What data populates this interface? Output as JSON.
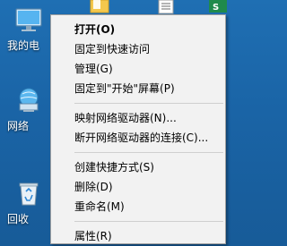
{
  "desktop": {
    "icons": [
      {
        "label": "我的电",
        "icon": "computer-icon"
      },
      {
        "label": "网络",
        "icon": "network-icon"
      },
      {
        "label": "回收",
        "icon": "recycle-bin-icon"
      }
    ],
    "top_icons": [
      "folder-icon",
      "document-icon",
      "spreadsheet-icon"
    ]
  },
  "context_menu": {
    "groups": [
      [
        {
          "label": "打开(O)",
          "default": true
        },
        {
          "label": "固定到快速访问"
        },
        {
          "label": "管理(G)"
        },
        {
          "label": "固定到\"开始\"屏幕(P)"
        }
      ],
      [
        {
          "label": "映射网络驱动器(N)..."
        },
        {
          "label": "断开网络驱动器的连接(C)..."
        }
      ],
      [
        {
          "label": "创建快捷方式(S)"
        },
        {
          "label": "删除(D)"
        },
        {
          "label": "重命名(M)"
        }
      ],
      [
        {
          "label": "属性(R)"
        }
      ]
    ]
  },
  "colors": {
    "desktop_background": "#1a64a6",
    "menu_background": "#f2f2f2",
    "menu_border": "#a0a0a0",
    "separator": "#cfcfcf"
  }
}
